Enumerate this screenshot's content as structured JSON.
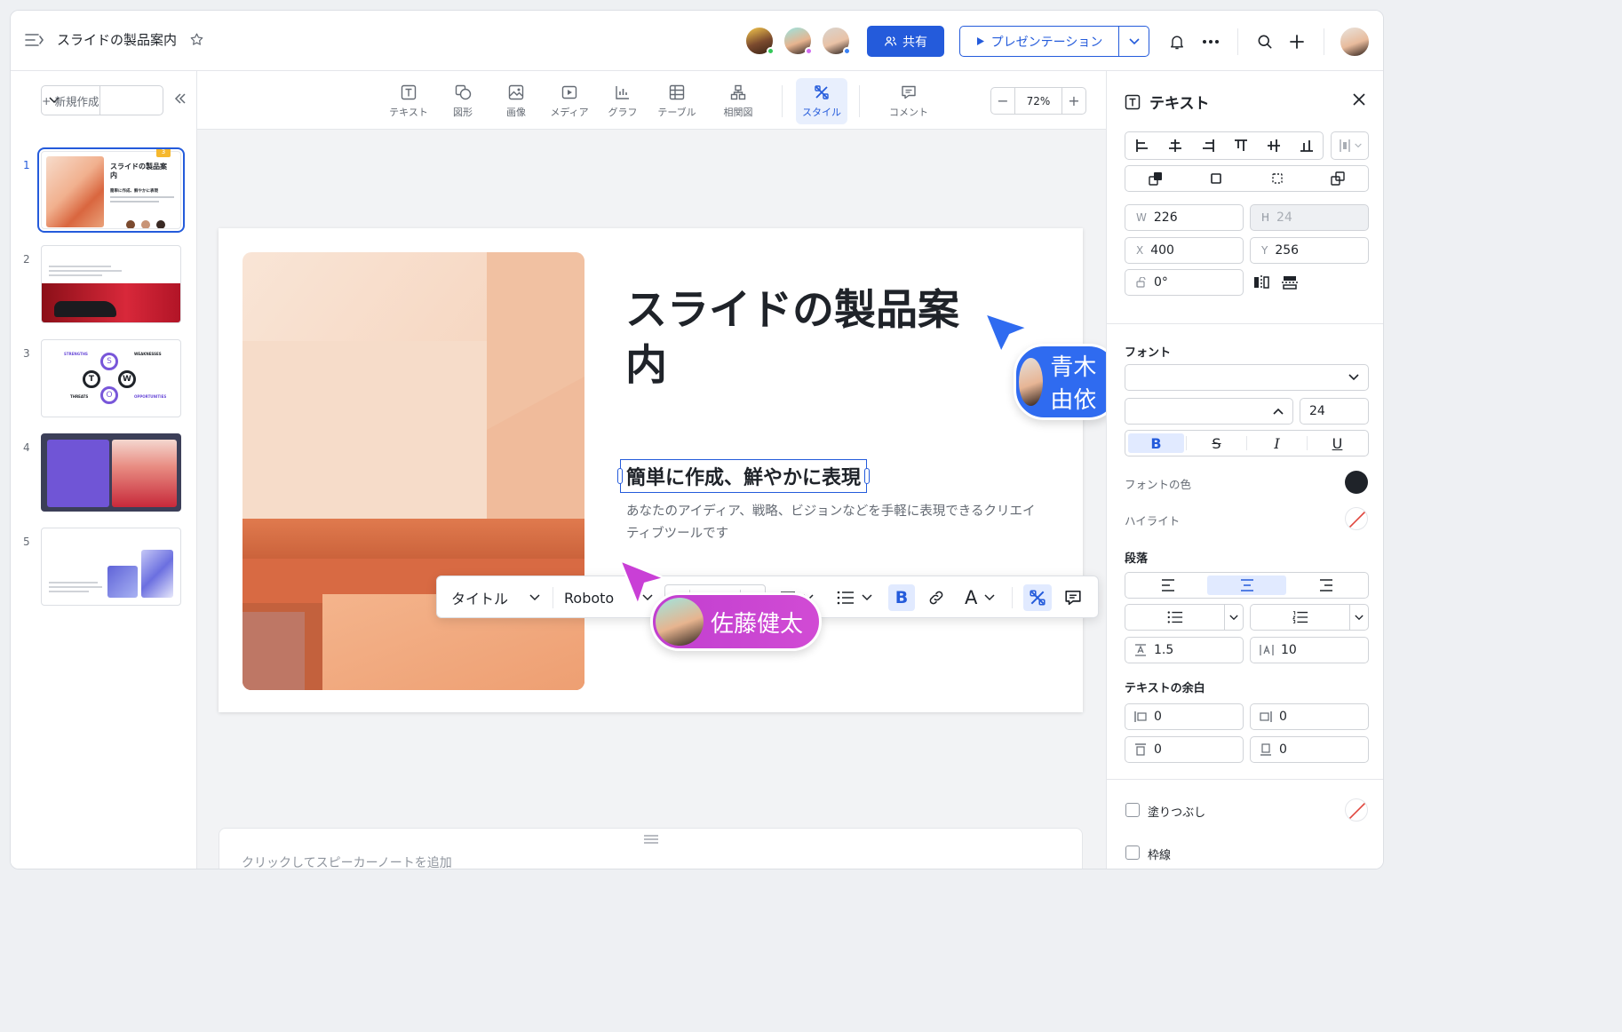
{
  "header": {
    "doc_title": "スライドの製品案内",
    "share_label": "共有",
    "present_label": "プレゼンテーション"
  },
  "left_panel": {
    "new_label": "新規作成",
    "thumb_badge": "3",
    "thumbs": [
      {
        "num": "1",
        "title": "スライドの製品案内",
        "sub": "簡単に作成、鮮やかに表現"
      },
      {
        "num": "2"
      },
      {
        "num": "3",
        "swot": {
          "s": "S",
          "w": "W",
          "t": "T",
          "o": "O",
          "strengths": "STRENGTHS",
          "weaknesses": "WEAKNESSES",
          "threats": "THREATS",
          "opportunities": "OPPORTUNITIES"
        }
      },
      {
        "num": "4"
      },
      {
        "num": "5"
      }
    ]
  },
  "toolbar": {
    "tools": [
      "テキスト",
      "図形",
      "画像",
      "メディア",
      "グラフ",
      "テーブル",
      "相関図",
      "スタイル",
      "コメント"
    ],
    "zoom": "72%"
  },
  "slide": {
    "title": "スライドの製品案内",
    "subtitle": "簡単に作成、鮮やかに表現",
    "body": "あなたのアイディア、戦略、ビジョンなどを手軽に表現できるクリエイティブツールです"
  },
  "floatbar": {
    "style": "タイトル",
    "font": "Roboto",
    "size": "24"
  },
  "cursors": [
    {
      "name": "青木由依",
      "color": "#2f6bf0"
    },
    {
      "name": "佐藤健太",
      "color": "#c93fd6"
    }
  ],
  "notes_placeholder": "クリックしてスピーカーノートを追加",
  "right_panel": {
    "title": "テキスト",
    "w_label": "W",
    "w": "226",
    "h_label": "H",
    "h": "24",
    "x_label": "X",
    "x": "400",
    "y_label": "Y",
    "y": "256",
    "rotation": "0°",
    "font_section": "フォント",
    "font_size": "24",
    "font_color_label": "フォントの色",
    "highlight_label": "ハイライト",
    "paragraph_label": "段落",
    "line_height": "1.5",
    "letter_spacing": "10",
    "margin_label": "テキストの余白",
    "margins": [
      "0",
      "0",
      "0",
      "0"
    ],
    "fill_label": "塗りつぶし",
    "border_label": "枠線"
  },
  "colors": {
    "accent": "#245bdb",
    "font_color": "#1f2329"
  }
}
